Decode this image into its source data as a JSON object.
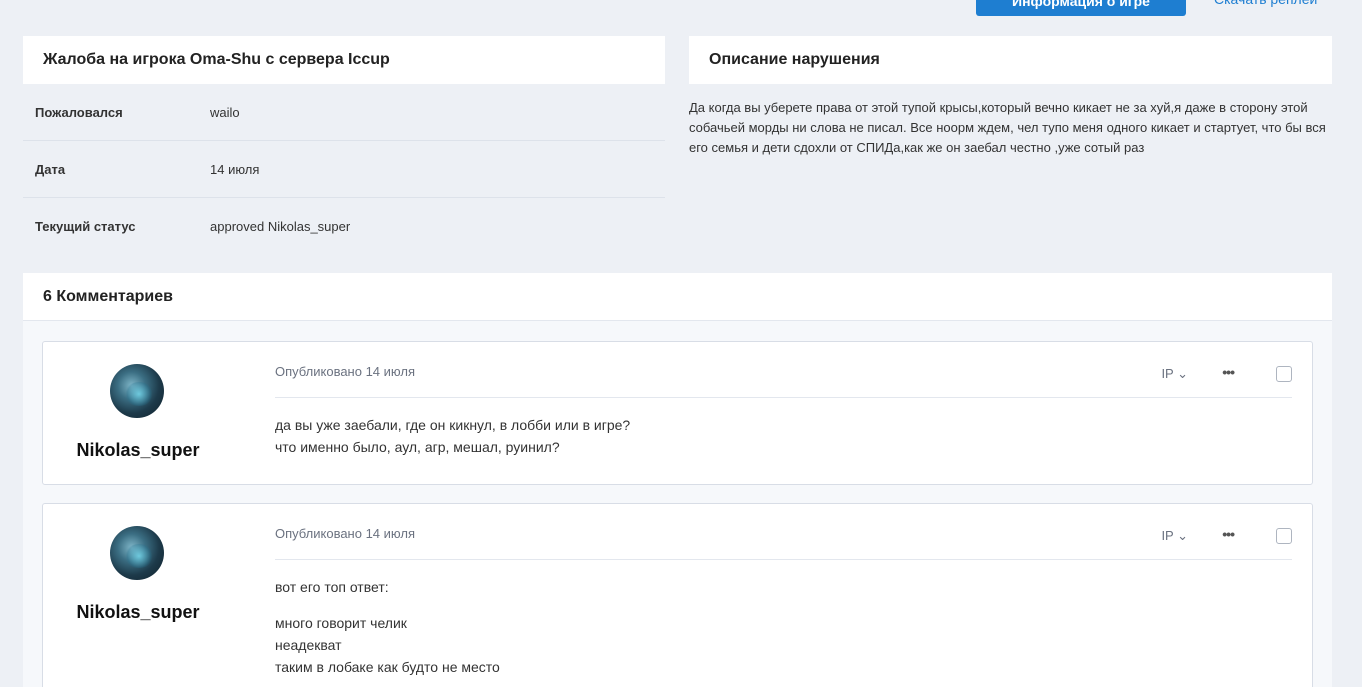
{
  "actions": {
    "info_button": "Информация о игре",
    "replays_link": "Скачать реплеи"
  },
  "complaint": {
    "title": "Жалоба на игрока Oma-Shu с сервера Iccup",
    "rows": [
      {
        "key": "Пожаловался",
        "value": "wailo"
      },
      {
        "key": "Дата",
        "value": "14 июля"
      },
      {
        "key": "Текущий статус",
        "value": "approved Nikolas_super"
      }
    ]
  },
  "description": {
    "title": "Описание нарушения",
    "text": "Да когда вы уберете права от этой тупой крысы,который вечно кикает не за хуй,я даже в сторону этой собачьей морды ни слова не писал. Все ноорм ждем, чел тупо меня одного кикает и стартует, что бы вся его семья и дети сдохли от СПИДа,как же он заебал честно ,уже сотый раз"
  },
  "comments": {
    "title": "6 Комментариев",
    "items": [
      {
        "author": "Nikolas_super",
        "published": "Опубликовано 14 июля",
        "ip": "IP ⌄",
        "more": "•••",
        "lines": [
          "да вы уже заебали, где он кикнул, в лобби или в игре?",
          "что именно было, аул, агр, мешал, руинил?"
        ]
      },
      {
        "author": "Nikolas_super",
        "published": "Опубликовано 14 июля",
        "ip": "IP ⌄",
        "more": "•••",
        "lines": [
          "вот его топ ответ:",
          "много говорит челик",
          "неадекват",
          "таким в лобаке как будто не место"
        ]
      }
    ]
  }
}
